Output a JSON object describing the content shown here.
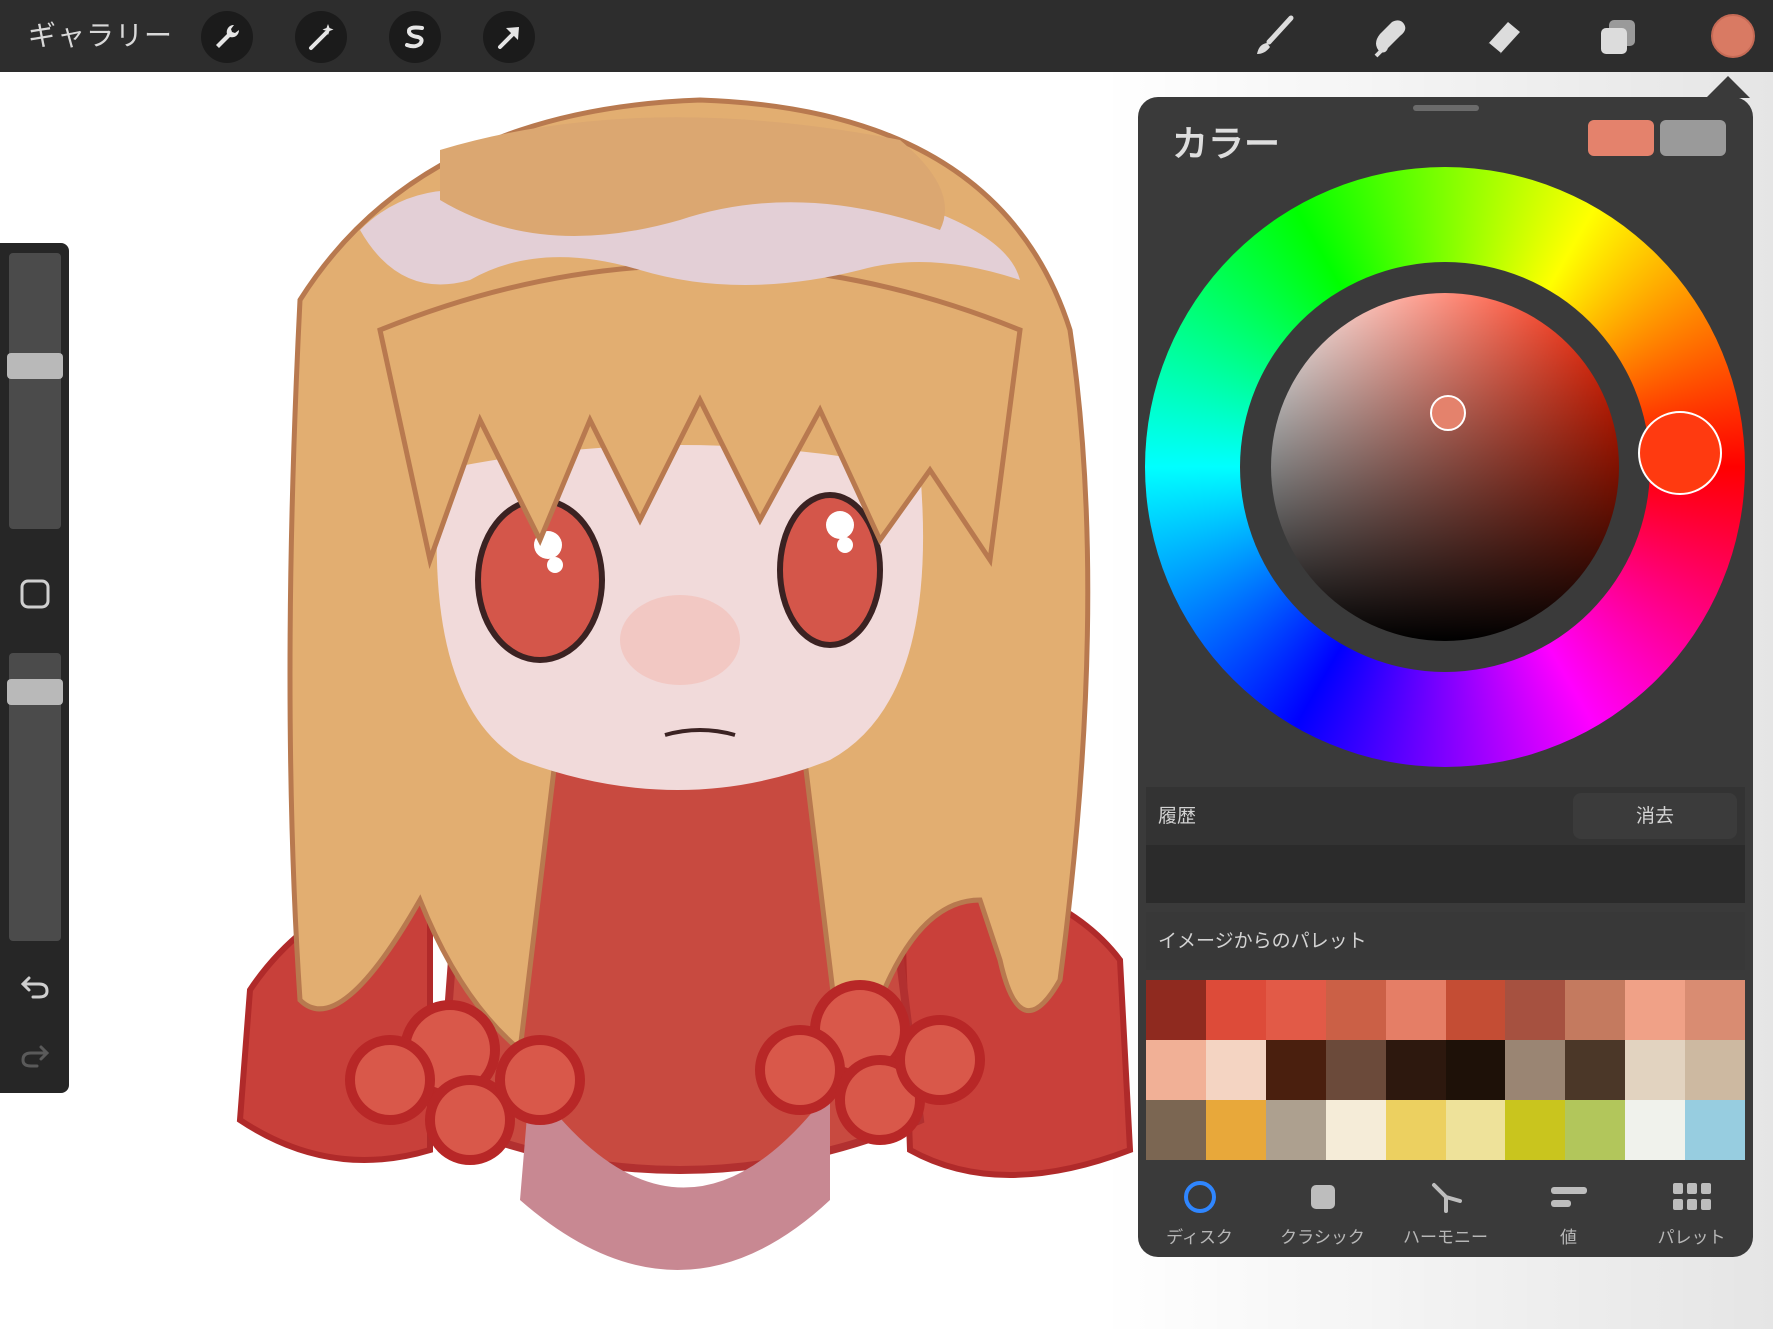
{
  "topbar": {
    "gallery_label": "ギャラリー",
    "left_tools": [
      "wrench-icon",
      "magic-wand-icon",
      "selection-s-icon",
      "move-arrow-icon"
    ],
    "right_tools": [
      "brush-icon",
      "smudge-icon",
      "eraser-icon",
      "layers-icon"
    ],
    "current_color": "#d97a63"
  },
  "sidebar": {
    "brush_size_level": 0.6,
    "opacity_level": 0.9,
    "modify_button_icon": "square-icon",
    "undo_icon": "undo-icon",
    "redo_icon": "redo-icon"
  },
  "color_panel": {
    "title": "カラー",
    "primary_color": "#e4826c",
    "secondary_color": "#9a9a9a",
    "hue_knob_color": "#ff3a10",
    "saturation_knob_color": "#e4826c",
    "history": {
      "label": "履歴",
      "clear_label": "消去"
    },
    "palette_from_image": {
      "label": "イメージからのパレット",
      "colors": [
        "#8f2a1f",
        "#dd4b39",
        "#e25a47",
        "#cb6046",
        "#e57e66",
        "#c44d34",
        "#a65140",
        "#c47a5f",
        "#f0a187",
        "#d98c72",
        "#f1b096",
        "#f4d4c2",
        "#4a1f0e",
        "#6b4a3a",
        "#2d180e",
        "#1e1108",
        "#9a8573",
        "#4b3728",
        "#e2d3c0",
        "#cdb9a1",
        "#7b6652",
        "#e8a83a",
        "#ada08f",
        "#f5ecd8",
        "#ecd060",
        "#eee29a",
        "#c9c51e",
        "#b2c65b",
        "#f0f2ec",
        "#97cde0"
      ]
    },
    "tabs": [
      {
        "label": "ディスク",
        "icon": "disc-icon"
      },
      {
        "label": "クラシック",
        "icon": "square-icon"
      },
      {
        "label": "ハーモニー",
        "icon": "harmony-icon"
      },
      {
        "label": "値",
        "icon": "value-sliders-icon"
      },
      {
        "label": "パレット",
        "icon": "palette-grid-icon"
      }
    ],
    "active_tab": "ディスク"
  }
}
